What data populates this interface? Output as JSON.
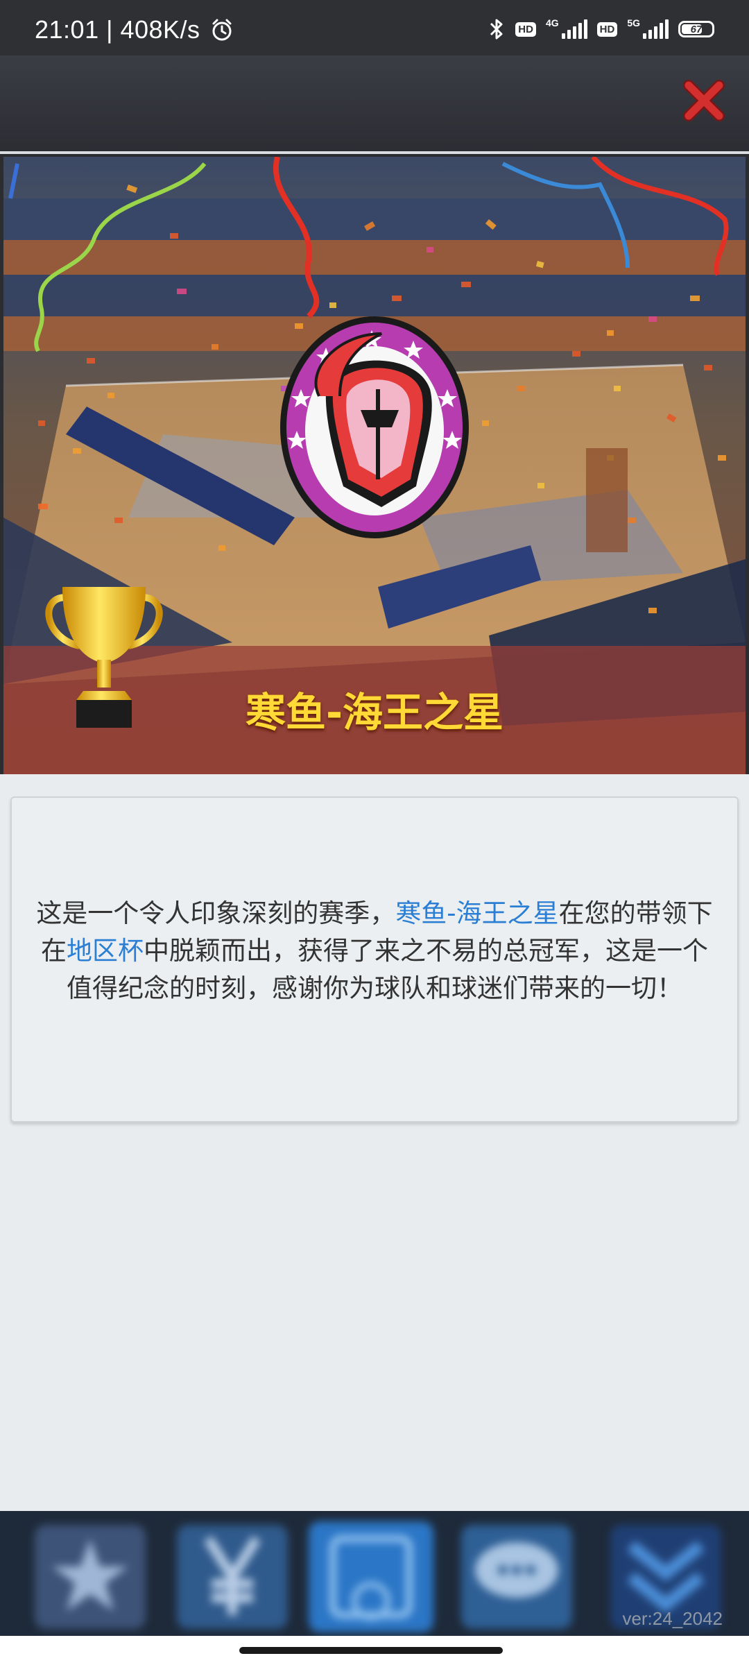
{
  "status_bar": {
    "time": "21:01 | 408K/s",
    "icons": [
      "alarm-icon",
      "bluetooth-icon",
      "signal-icon",
      "battery-icon"
    ],
    "hd1": "HD",
    "net1": "4G",
    "hd2": "HD",
    "net2": "5G",
    "battery": "67"
  },
  "dialog": {
    "close_icon": "close-icon",
    "team_name": "寒鱼-海王之星",
    "message": {
      "part1": "这是一个令人印象深刻的赛季，",
      "team": "寒鱼-海王之星",
      "part2": "在您的带领下在",
      "cup": "地区杯",
      "part3": "中脱颖而出，获得了来之不易的总冠军，这是一个值得纪念的时刻，感谢你为球队和球迷们带来的一切！"
    }
  },
  "colors": {
    "title_gold": "#ffd935",
    "highlight_blue": "#2a7fd4",
    "close_red": "#d32f2f",
    "logo_purple": "#b63cb0"
  },
  "bottom_nav": {
    "version": "ver:24_2042"
  }
}
